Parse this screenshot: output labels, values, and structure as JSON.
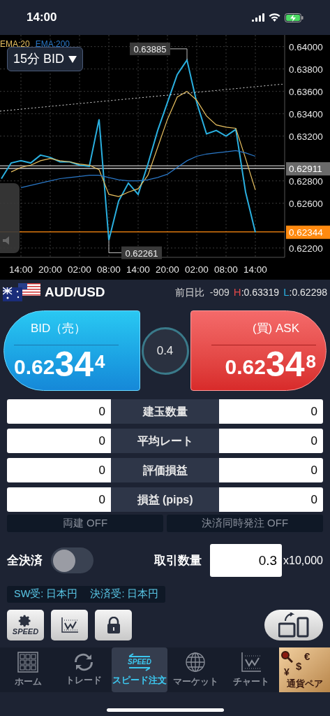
{
  "status_bar": {
    "time": "14:00"
  },
  "chart": {
    "timeframe": "15分 BID",
    "chart_data": {
      "type": "line",
      "grid": true,
      "categories": [
        null,
        null,
        "14:00",
        null,
        null,
        "20:00",
        null,
        null,
        "02:00",
        null,
        null,
        "08:00",
        null,
        null,
        "14:00",
        null,
        null,
        "20:00",
        null,
        null,
        "02:00",
        null,
        null,
        "08:00",
        null,
        null,
        "14:00"
      ],
      "yticks": [
        {
          "value": 0.64,
          "label": "0.64000"
        },
        {
          "value": 0.638,
          "label": "0.63800"
        },
        {
          "value": 0.636,
          "label": "0.63600"
        },
        {
          "value": 0.634,
          "label": "0.63400"
        },
        {
          "value": 0.632,
          "label": "0.63200"
        },
        {
          "value": 0.628,
          "label": "0.62800"
        },
        {
          "value": 0.626,
          "label": "0.62600"
        },
        {
          "value": 0.622,
          "label": "0.62200"
        }
      ],
      "ylim": [
        0.62117,
        0.64104
      ],
      "series": [
        {
          "color": "#2ab0e0",
          "values": [
            0.6282,
            0.6296,
            0.6298,
            0.6296,
            0.6303,
            0.6301,
            0.6297,
            0.6297,
            0.6294,
            0.6293,
            0.6335,
            0.6227,
            0.6262,
            0.6278,
            0.6268,
            0.6295,
            0.6325,
            0.635,
            0.6375,
            0.6388,
            0.635,
            0.6322,
            0.6325,
            0.632,
            0.6326,
            0.627,
            0.6234
          ]
        },
        {
          "name": "EMA:20",
          "color": "#e8c060",
          "values": [
            null,
            0.6288,
            0.6292,
            0.6294,
            0.6298,
            0.63,
            0.6298,
            0.6297,
            0.6295,
            0.6294,
            0.629,
            0.6268,
            0.6266,
            0.627,
            0.6273,
            0.6285,
            0.631,
            0.6335,
            0.6355,
            0.636,
            0.6352,
            0.6338,
            0.633,
            0.6328,
            0.6327,
            0.63,
            0.6272
          ]
        },
        {
          "name": "EMA:200",
          "color": "#2a78c8",
          "values": [
            null,
            null,
            0.6274,
            0.6276,
            0.6278,
            0.628,
            0.6282,
            0.6283,
            0.6284,
            0.6285,
            0.6285,
            0.6283,
            0.6281,
            0.628,
            0.628,
            0.6281,
            0.6283,
            0.6286,
            0.6292,
            0.6298,
            0.6302,
            0.6304,
            0.6305,
            0.6306,
            0.6307,
            0.6305,
            0.6302
          ]
        }
      ],
      "ref_lines": [
        {
          "axis": "y",
          "value": 0.62935,
          "color": "#e0e0e0"
        },
        {
          "axis": "y",
          "value": 0.62911,
          "color": "#e0e0e0",
          "label": "0.62911"
        },
        {
          "axis": "y",
          "value": 0.62344,
          "color": "#ff8a10",
          "label": "0.62344"
        }
      ],
      "annotations": [
        "0.63885",
        "0.62261"
      ]
    }
  },
  "pair": {
    "name": "AUD/USD",
    "change_label": "前日比",
    "change": "-909",
    "high_label": "H",
    "high": ":0.63319",
    "low_label": "L",
    "low": ":0.62298"
  },
  "quotes": [
    {
      "kind": "bid",
      "label": "BID（売）",
      "price_main": "0.62",
      "price_big": "34",
      "price_small": "4"
    },
    {
      "kind": "ask",
      "label": "(買) ASK",
      "price_main": "0.62",
      "price_big": "34",
      "price_small": "8"
    }
  ],
  "spread": "0.4",
  "positions": [
    {
      "label": "建玉数量",
      "sell": "0",
      "buy": "0"
    },
    {
      "label": "平均レート",
      "sell": "0",
      "buy": "0"
    },
    {
      "label": "評価損益",
      "sell": "0",
      "buy": "0"
    },
    {
      "label": "損益 (pips)",
      "sell": "0",
      "buy": "0"
    }
  ],
  "toggles": [
    {
      "label": "両建 OFF"
    },
    {
      "label": "決済同時発注 OFF"
    }
  ],
  "close_all": {
    "label": "全決済",
    "on": false
  },
  "quantity": {
    "label": "取引数量",
    "value": "0.3",
    "unit": "x10,000"
  },
  "settlement": [
    "SW受: 日本円",
    "決済受: 日本円"
  ],
  "tools": [
    {
      "kind": "speed",
      "text": "SPEED"
    },
    {
      "kind": "chart"
    },
    {
      "kind": "lock"
    }
  ],
  "tabs": [
    {
      "kind": "home",
      "label": "ホーム",
      "selected": false
    },
    {
      "kind": "trade",
      "label": "トレード",
      "selected": false
    },
    {
      "kind": "speed",
      "label": "スピード注文",
      "text": "SPEED",
      "selected": true
    },
    {
      "kind": "market",
      "label": "マーケット",
      "selected": false
    },
    {
      "kind": "chart",
      "label": "チャート",
      "selected": false
    },
    {
      "kind": "banner",
      "label": "通貨ペア",
      "symbols": [
        "€",
        "¥",
        "$"
      ],
      "selected": false
    }
  ]
}
